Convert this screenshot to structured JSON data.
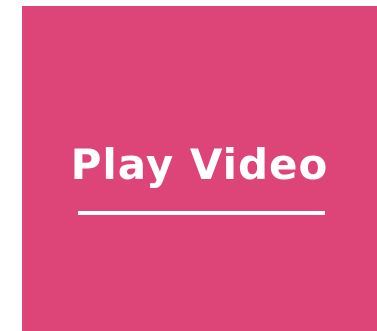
{
  "video_card": {
    "label": "Play Video",
    "background_color": "#dd4477",
    "text_color": "#ffffff"
  }
}
